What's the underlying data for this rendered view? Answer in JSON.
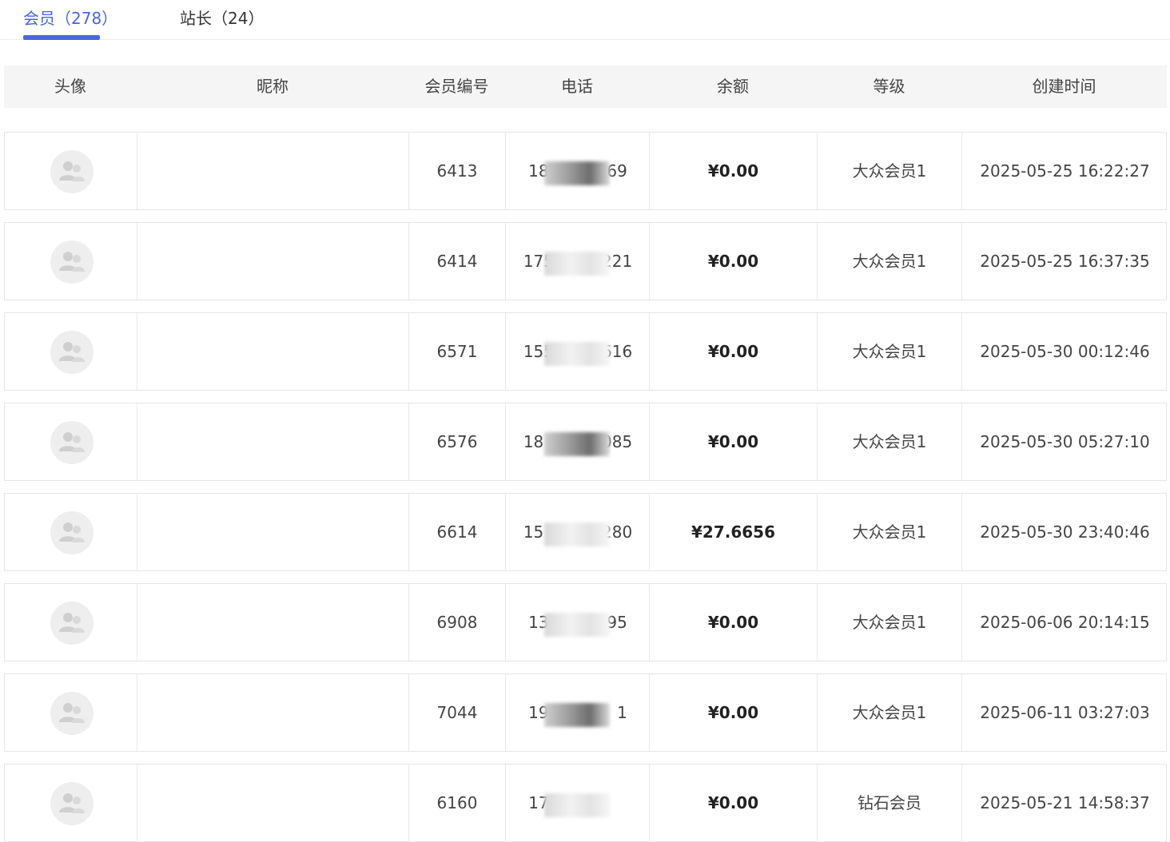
{
  "tabs": [
    {
      "label": "会员（278）",
      "active": true
    },
    {
      "label": "站长（24）",
      "active": false
    }
  ],
  "accent_color": "#4a66e0",
  "columns": [
    "头像",
    "昵称",
    "会员编号",
    "电话",
    "余额",
    "等级",
    "创建时间"
  ],
  "rows": [
    {
      "avatar": "user-placeholder-icon",
      "nickname": "",
      "id": "6413",
      "phone_prefix": "18",
      "phone_suffix": "269",
      "balance": "¥0.00",
      "level": "大众会员1",
      "created": "2025-05-25 16:22:27"
    },
    {
      "avatar": "user-placeholder-icon",
      "nickname": "",
      "id": "6414",
      "phone_prefix": "175",
      "phone_suffix": "221",
      "balance": "¥0.00",
      "level": "大众会员1",
      "created": "2025-05-25 16:37:35"
    },
    {
      "avatar": "user-placeholder-icon",
      "nickname": "",
      "id": "6571",
      "phone_prefix": "155",
      "phone_suffix": "616",
      "balance": "¥0.00",
      "level": "大众会员1",
      "created": "2025-05-30 00:12:46"
    },
    {
      "avatar": "user-placeholder-icon",
      "nickname": "",
      "id": "6576",
      "phone_prefix": "18",
      "phone_suffix": "3085",
      "balance": "¥0.00",
      "level": "大众会员1",
      "created": "2025-05-30 05:27:10"
    },
    {
      "avatar": "user-placeholder-icon",
      "nickname": "",
      "id": "6614",
      "phone_prefix": "15",
      "phone_suffix": "4280",
      "balance": "¥27.6656",
      "level": "大众会员1",
      "created": "2025-05-30 23:40:46"
    },
    {
      "avatar": "user-placeholder-icon",
      "nickname": "",
      "id": "6908",
      "phone_prefix": "137",
      "phone_suffix": "95",
      "balance": "¥0.00",
      "level": "大众会员1",
      "created": "2025-06-06 20:14:15"
    },
    {
      "avatar": "user-placeholder-icon",
      "nickname": "",
      "id": "7044",
      "phone_prefix": "1998",
      "phone_suffix": "1",
      "balance": "¥0.00",
      "level": "大众会员1",
      "created": "2025-06-11 03:27:03"
    },
    {
      "avatar": "user-placeholder-icon",
      "nickname": "",
      "id": "6160",
      "phone_prefix": "17322",
      "phone_suffix": "",
      "balance": "¥0.00",
      "level": "钻石会员",
      "created": "2025-05-21 14:58:37"
    }
  ]
}
